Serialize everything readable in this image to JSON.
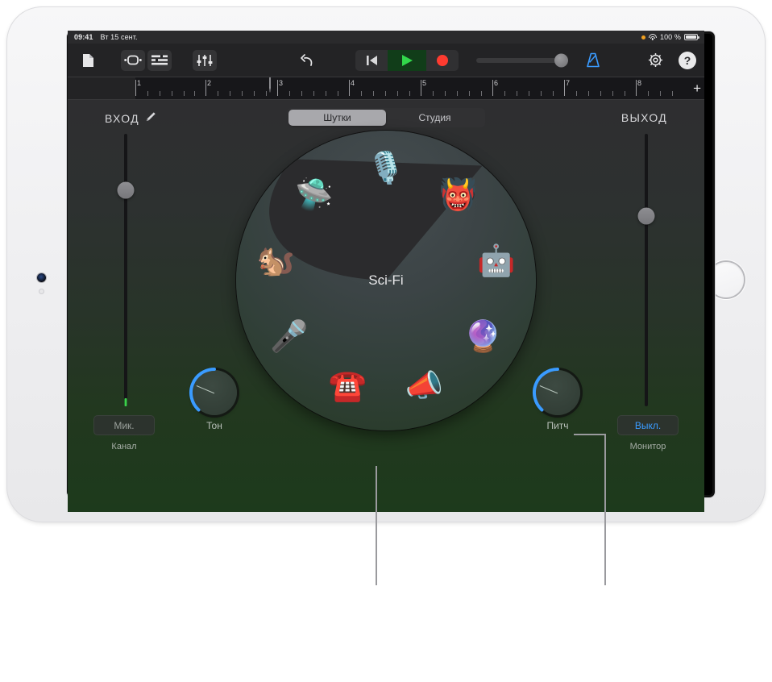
{
  "status_bar": {
    "time": "09:41",
    "date": "Вт 15 сент.",
    "battery_percent": "100 %",
    "recording_dot": "recording-indicator-dot",
    "wifi_icon": "wifi-icon",
    "battery_icon": "battery-icon"
  },
  "toolbar": {
    "document_icon": "document-icon",
    "loop_icon": "loop-browser-icon",
    "tracks_icon": "tracks-view-icon",
    "mixer_icon": "mixer-faders-icon",
    "undo_icon": "undo-arrow-icon",
    "rewind_icon": "rewind-to-start-icon",
    "play_icon": "play-icon",
    "record_icon": "record-icon",
    "volume_slider": "master-volume-slider",
    "metronome_icon": "metronome-icon",
    "settings_icon": "settings-gear-icon",
    "help_label": "?"
  },
  "ruler": {
    "bars": [
      "1",
      "2",
      "3",
      "4",
      "5",
      "6",
      "7",
      "8"
    ],
    "playhead_bar": "3",
    "add_label": "+"
  },
  "panel": {
    "input_label": "ВХОД",
    "input_icon": "input-tool-icon",
    "output_label": "ВЫХОД",
    "input_slider": "input-level-slider",
    "output_slider": "output-level-slider"
  },
  "segmented_control": {
    "options": [
      {
        "label": "Шутки",
        "selected": true
      },
      {
        "label": "Студия",
        "selected": false
      }
    ]
  },
  "wheel": {
    "center_label": "Sci-Fi",
    "selected_index": 8,
    "slots": [
      {
        "name": "microphone-vintage-icon",
        "glyph": "🎙️",
        "angle": 0
      },
      {
        "name": "monster-icon",
        "glyph": "👹",
        "angle": 40
      },
      {
        "name": "robot-icon",
        "glyph": "🤖",
        "angle": 80
      },
      {
        "name": "bubbles-icon",
        "glyph": "🔮",
        "angle": 120
      },
      {
        "name": "megaphone-icon",
        "glyph": "📣",
        "angle": 160
      },
      {
        "name": "telephone-icon",
        "glyph": "☎️",
        "angle": 200
      },
      {
        "name": "microphone-gold-icon",
        "glyph": "🎤",
        "angle": 240
      },
      {
        "name": "chipmunk-icon",
        "glyph": "🐿️",
        "angle": 280
      },
      {
        "name": "ufo-icon",
        "glyph": "🛸",
        "angle": 320
      }
    ]
  },
  "controls": {
    "tone_knob_label": "Тон",
    "pitch_knob_label": "Питч",
    "channel_value": "Мик.",
    "channel_label": "Канал",
    "monitor_value": "Выкл.",
    "monitor_label": "Монитор"
  },
  "colors": {
    "accent_blue": "#3a9bff",
    "play_green": "#32d74b",
    "record_red": "#ff3b30",
    "knob_arc": "#3a9bff"
  }
}
